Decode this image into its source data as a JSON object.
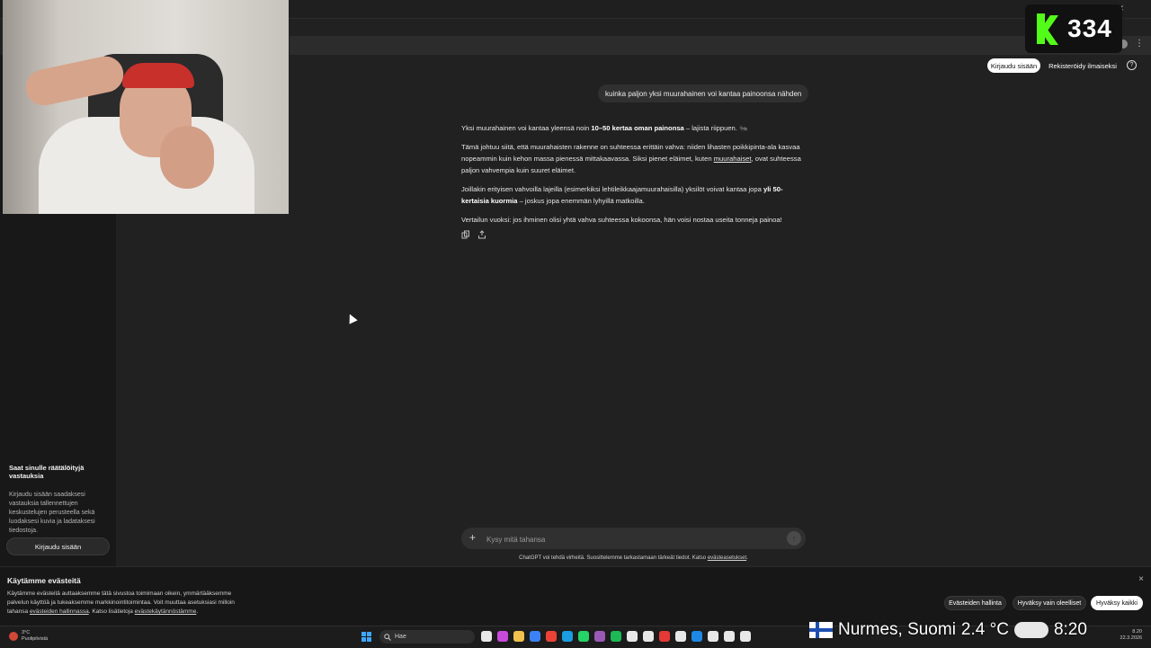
{
  "overlay": {
    "counter": "334",
    "location": "Nurmes, Suomi",
    "temperature": "2.4 °C",
    "time": "8:20"
  },
  "header": {
    "login_label": "Kirjaudu sisään",
    "signup_label": "Rekisteröidy ilmaiseksi",
    "help_label": "?"
  },
  "chat": {
    "user_message": "kuinka paljon yksi muurahainen voi kantaa painoonsa nähden",
    "answer": {
      "p1_pre": "Yksi muurahainen voi kantaa yleensä noin ",
      "p1_bold": "10–50 kertaa oman painonsa",
      "p1_post": " – lajista riippuen. 🐜",
      "p2_pre": "Tämä johtuu siitä, että muurahaisten rakenne on suhteessa erittäin vahva: niiden lihasten poikkipinta-ala kasvaa nopeammin kuin kehon massa pienessä mittakaavassa. Siksi pienet eläimet, kuten ",
      "p2_link": "muurahaiset",
      "p2_post": ", ovat suhteessa paljon vahvempia kuin suuret eläimet.",
      "p3_pre": "Joillakin erityisen vahvoilla lajeilla (esimerkiksi lehtileikkaajamuurahaisilla) yksilöt voivat kantaa jopa ",
      "p3_bold": "yli 50-kertaisia kuormia",
      "p3_post": " – joskus jopa enemmän lyhyillä matkoilla.",
      "p4": "Vertailun vuoksi: jos ihminen olisi yhtä vahva suhteessa kokoonsa, hän voisi nostaa useita tonneja painoa!"
    }
  },
  "composer": {
    "placeholder": "Kysy mitä tahansa",
    "disclaimer_pre": "ChatGPT voi tehdä virheitä. Suosittelemme tarkastamaan tärkeät tiedot. Katso ",
    "disclaimer_link": "evästeasetukset",
    "disclaimer_post": "."
  },
  "sidebar": {
    "promo_title": "Saat sinulle räätälöityjä vastauksia",
    "promo_body": "Kirjaudu sisään saadaksesi vastauksia tallennettujen keskustelujen perusteella sekä luodaksesi kuvia ja ladataksesi tiedostoja.",
    "login_label": "Kirjaudu sisään"
  },
  "cookie": {
    "title": "Käytämme evästeitä",
    "body_pre": "Käytämme evästeitä auttaaksemme tätä sivustoa toimimaan oikein, ymmärtääksemme palvelun käyttöä ja tukeaksemme markkinointitoimintaa. Voit muuttaa asetuksiasi milloin tahansa ",
    "link1": "evästeiden hallinnassa",
    "body_mid": ". Katso lisätietoja ",
    "link2": "evästekäytännöstämme",
    "body_post": ".",
    "btn_manage": "Evästeiden hallinta",
    "btn_essential": "Hyväksy vain oleelliset",
    "btn_accept": "Hyväksy kaikki",
    "close": "×"
  },
  "taskbar": {
    "weather_temp": "3°C",
    "weather_desc": "Puolipilvistä",
    "search_label": "Hae",
    "clock_time": "8.20",
    "clock_date": "22.3.2026",
    "app_colors": [
      "#e8e8e8",
      "#c74bd9",
      "#f2c14e",
      "#3b82f6",
      "#ea4335",
      "#1b9de2",
      "#25d366",
      "#9b59b6",
      "#1db954",
      "#e8e8e8",
      "#e8e8e8",
      "#e53935",
      "#e8e8e8",
      "#1e88e5",
      "#e8e8e8",
      "#e8e8e8",
      "#e8e8e8"
    ]
  },
  "colors": {
    "page_bg": "#212121",
    "sidebar_bg": "#181818",
    "kick_green": "#53fc18"
  }
}
